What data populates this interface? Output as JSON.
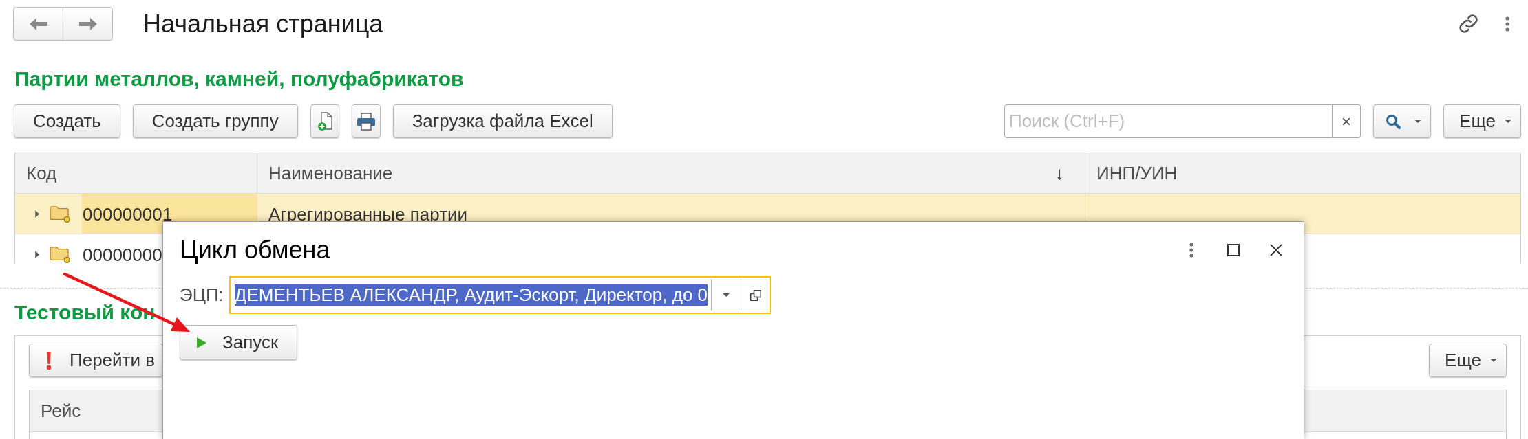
{
  "header": {
    "title": "Начальная страница"
  },
  "batches": {
    "title": "Партии металлов, камней, полуфабрикатов",
    "toolbar": [
      {
        "kind": "text",
        "label": "Создать"
      },
      {
        "kind": "text",
        "label": "Создать группу"
      },
      {
        "kind": "add"
      },
      {
        "kind": "print"
      },
      {
        "kind": "text",
        "label": "Загрузка файла Excel"
      }
    ],
    "search": {
      "placeholder": "Поиск (Ctrl+F)",
      "clear": "×"
    },
    "more_button": {
      "label": "Еще"
    },
    "table": {
      "columns": [
        {
          "label": "Код"
        },
        {
          "label": "Наименование",
          "sort_mark": "↓"
        },
        {
          "label": "ИНП/УИН"
        }
      ],
      "rows": [
        {
          "code": "000000001",
          "name": "Агрегированные партии",
          "expanded": false,
          "selected": true
        },
        {
          "code": "00000000",
          "expanded": false,
          "selected": false
        }
      ]
    }
  },
  "test_section": {
    "title": "Тестовый кон",
    "toolbar": [
      {
        "kind": "alert",
        "label": "Перейти в"
      }
    ],
    "more_button": {
      "label": "Еще"
    },
    "table": {
      "columns": [
        {
          "label": "Рейс"
        }
      ]
    }
  },
  "dialog": {
    "title": "Цикл обмена",
    "field": {
      "label": "ЭЦП:",
      "value": "ДЕМЕНТЬЕВ АЛЕКСАНДР, Аудит-Эскорт, Директор, до 0",
      "focused": true,
      "highlighted": true
    },
    "run_button": {
      "label": "Запуск"
    }
  }
}
